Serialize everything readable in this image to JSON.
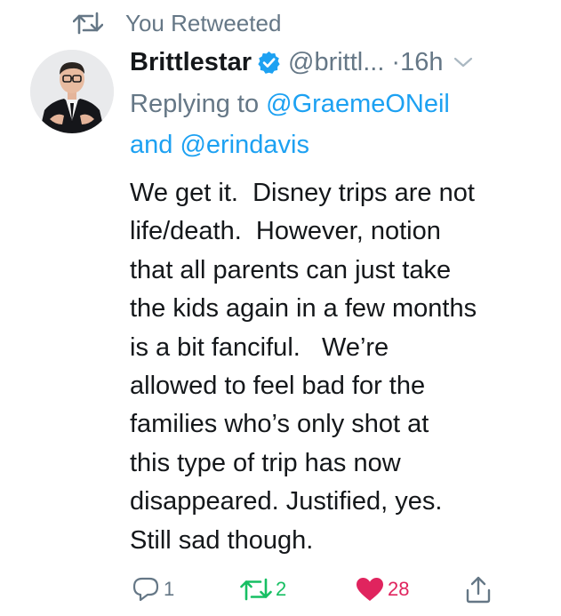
{
  "retweet_notice": "You Retweeted",
  "author": {
    "display_name": "Brittlestar",
    "handle": "@brittl...",
    "timestamp_separator": "·",
    "timestamp": "16h"
  },
  "reply_context": {
    "prefix": "Replying to",
    "mention_1": "@GraemeONeil",
    "joiner": "and",
    "mention_2": "@erindavis"
  },
  "tweet_lines": [
    "We get it.  Disney trips are not",
    "life/death.  However, notion",
    "that all parents can just take",
    "the kids again in a few months",
    "is a bit fanciful.   We’re",
    "allowed to feel bad for the",
    "families who’s only shot at",
    "this type of trip has now",
    "disappeared. Justified, yes.",
    "Still sad though."
  ],
  "actions": {
    "reply_count": "1",
    "retweet_count": "2",
    "like_count": "28"
  },
  "icons": {
    "retweet_notice": "retweet-icon",
    "verified": "verified-badge-icon",
    "menu": "chevron-down-icon",
    "reply": "reply-bubble-icon",
    "retweet": "retweet-icon",
    "like": "heart-icon",
    "share": "share-icon"
  },
  "colors": {
    "link_blue": "#1da1f2",
    "secondary_gray": "#657786",
    "retweet_green": "#17bf63",
    "like_red": "#e0245e"
  }
}
